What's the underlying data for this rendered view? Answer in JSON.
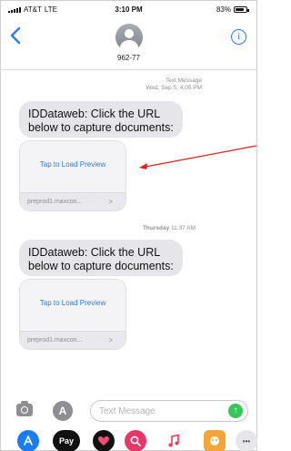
{
  "status_bar": {
    "carrier": "AT&T",
    "network": "LTE",
    "time": "3:10 PM",
    "battery": "83%",
    "battery_level": 0.83
  },
  "header": {
    "back_icon": "chevron-left-icon",
    "contact": "962-77",
    "info_glyph": "i"
  },
  "thread": {
    "timestamp1_line1": "Text Message",
    "timestamp1_line2": "Wed, Sep 5, 4:05 PM",
    "message1": "IDDataweb: Click the URL below to capture documents:",
    "preview1_load": "Tap to Load Preview",
    "preview1_url": "preprod1.maxcon...",
    "timestamp2_day": "Thursday",
    "timestamp2_time": "11:37 AM",
    "message2": "IDDataweb: Click the URL below to capture documents:",
    "preview2_load": "Tap to Load Preview",
    "preview2_url": "preprod1.maxcon...",
    "preview_chevron": ">"
  },
  "input": {
    "placeholder": "Text Message",
    "apps_glyph": "A",
    "send_glyph": "↑"
  },
  "drawer": {
    "pay_label": "Pay",
    "more_glyph": "•••"
  },
  "colors": {
    "ios_blue": "#2c7bf2",
    "annotation_red": "#e02020",
    "send_green": "#34c759",
    "bubble_gray": "#e5e5ea"
  }
}
